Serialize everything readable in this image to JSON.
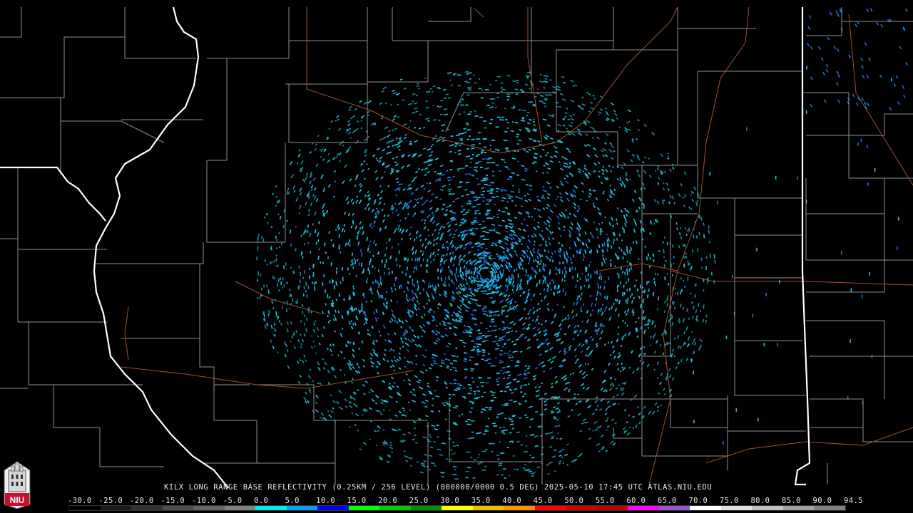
{
  "caption": "KILX LONG RANGE BASE REFLECTIVITY (0.25KM / 256 LEVEL) (000000/0000 0.5 DEG) 2025-05-10 17:45 UTC  ATLAS.NIU.EDU",
  "logo_text": "NIU",
  "scale": {
    "labels": [
      "-30.0",
      "-25.0",
      "-20.0",
      "-15.0",
      "-10.0",
      "-5.0",
      "0.0",
      "5.0",
      "10.0",
      "15.0",
      "20.0",
      "25.0",
      "30.0",
      "35.0",
      "40.0",
      "45.0",
      "50.0",
      "55.0",
      "60.0",
      "65.0",
      "70.0",
      "75.0",
      "80.0",
      "85.0",
      "90.0",
      "94.5"
    ],
    "colors": [
      "#000000",
      "#1a1a1a",
      "#333333",
      "#4d4d4d",
      "#666666",
      "#808080",
      "#00ecec",
      "#01a0f6",
      "#0000f6",
      "#00ff00",
      "#00c800",
      "#009000",
      "#ffff00",
      "#e7c000",
      "#ff9000",
      "#ff0000",
      "#d60000",
      "#c00000",
      "#ff00ff",
      "#9955c9",
      "#ffffff",
      "#e0e0e0",
      "#c0c0c0",
      "#a0a0a0",
      "#808080"
    ]
  },
  "colors": {
    "background": "#000000",
    "county_lines": "#9a9a9a",
    "state_lines": "#ffffff",
    "highways": "#a0522d",
    "echo_primary": "#1ec8e6",
    "echo_secondary": "#1e6ee6",
    "echo_green": "#22c822",
    "radar_site": "#000000"
  }
}
